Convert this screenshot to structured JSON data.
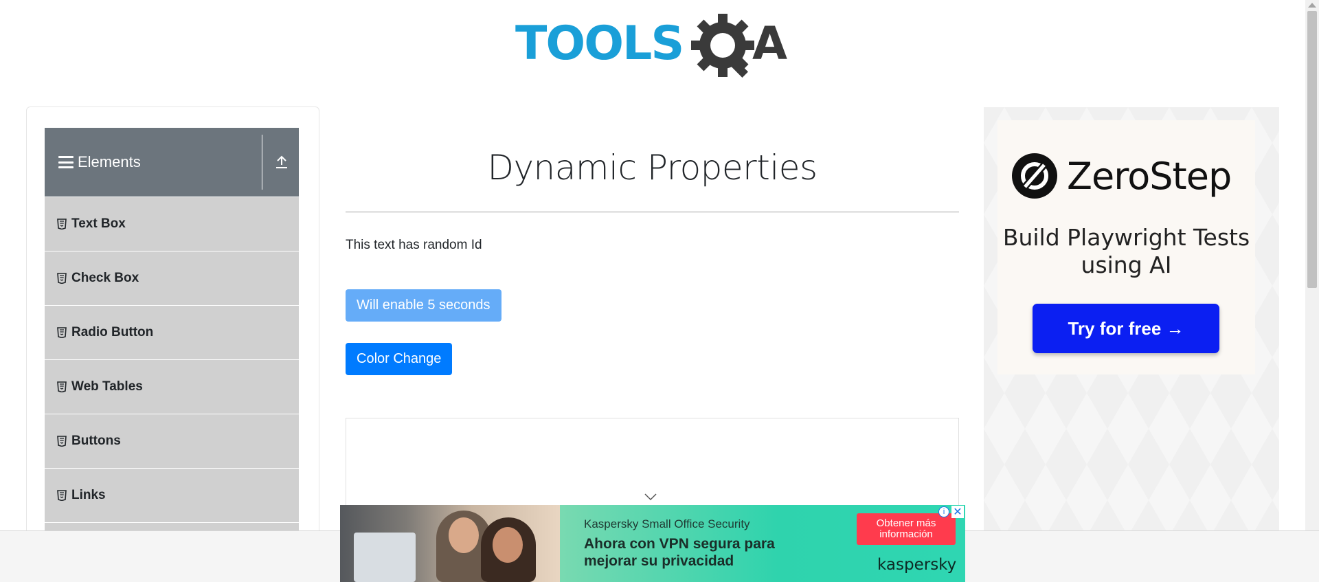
{
  "header": {
    "logo_text": "TOOLSQA"
  },
  "sidebar": {
    "group_title": "Elements",
    "items": [
      {
        "label": "Text Box"
      },
      {
        "label": "Check Box"
      },
      {
        "label": "Radio Button"
      },
      {
        "label": "Web Tables"
      },
      {
        "label": "Buttons"
      },
      {
        "label": "Links"
      }
    ]
  },
  "main": {
    "title": "Dynamic Properties",
    "random_id_text": "This text has random Id",
    "enable_button_label": "Will enable 5 seconds",
    "color_change_button_label": "Color Change"
  },
  "right_ad": {
    "brand": "ZeroStep",
    "headline": "Build Playwright Tests using AI",
    "cta": "Try for free →"
  },
  "bottom_ad": {
    "subtitle": "Kaspersky Small Office Security",
    "headline": "Ahora con VPN segura para mejorar su privacidad",
    "cta": "Obtener más información",
    "brand": "kaspersky",
    "info_symbol": "i",
    "close_symbol": "✕"
  },
  "colors": {
    "brand_blue": "#1a9fd8",
    "brand_dark": "#3a3a3a",
    "sidebar_header": "#6c757d",
    "sidebar_item": "#d0d0d0",
    "primary_button": "#007bff",
    "disabled_button": "#65acf8",
    "zerostep_cta": "#0b1ff2"
  }
}
